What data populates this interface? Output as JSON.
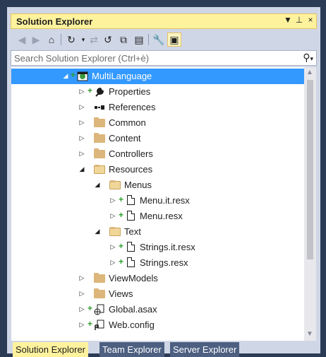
{
  "panel": {
    "title": "Solution Explorer",
    "controls": {
      "dropdown": "▼",
      "pin": "⊥",
      "close": "×"
    }
  },
  "toolbar": {
    "buttons": [
      "back-icon",
      "forward-icon",
      "home-icon",
      "history-icon",
      "sync-icon",
      "refresh-icon",
      "collapse-all-icon",
      "show-all-files-icon",
      "properties-icon",
      "preview-icon"
    ]
  },
  "search": {
    "placeholder": "Search Solution Explorer (Ctrl+è)",
    "icon": "⚲",
    "dropdown": "▾"
  },
  "tree": [
    {
      "label": "MultiLanguage",
      "icon": "project-icon",
      "expanded": true,
      "selected": true
    },
    {
      "label": "Properties",
      "icon": "wrench-icon",
      "expanded": false
    },
    {
      "label": "References",
      "icon": "references-icon",
      "expanded": false
    },
    {
      "label": "Common",
      "icon": "folder-icon",
      "expanded": false
    },
    {
      "label": "Content",
      "icon": "folder-icon",
      "expanded": false
    },
    {
      "label": "Controllers",
      "icon": "folder-icon",
      "expanded": false
    },
    {
      "label": "Resources",
      "icon": "folder-open-icon",
      "expanded": true
    },
    {
      "label": "Menus",
      "icon": "folder-open-icon",
      "expanded": true
    },
    {
      "label": "Menu.it.resx",
      "icon": "resx-file-icon",
      "expanded": false
    },
    {
      "label": "Menu.resx",
      "icon": "resx-file-icon",
      "expanded": false
    },
    {
      "label": "Text",
      "icon": "folder-open-icon",
      "expanded": true
    },
    {
      "label": "Strings.it.resx",
      "icon": "resx-file-icon",
      "expanded": false
    },
    {
      "label": "Strings.resx",
      "icon": "resx-file-icon",
      "expanded": false
    },
    {
      "label": "ViewModels",
      "icon": "folder-icon",
      "expanded": false
    },
    {
      "label": "Views",
      "icon": "folder-icon",
      "expanded": false
    },
    {
      "label": "Global.asax",
      "icon": "global-asax-icon",
      "expanded": false
    },
    {
      "label": "Web.config",
      "icon": "config-file-icon",
      "expanded": false
    }
  ],
  "tabs": [
    "Solution Explorer",
    "Team Explorer",
    "Server Explorer"
  ],
  "colors": {
    "title_active": "#fff29d",
    "selection": "#3399ff",
    "tab_inactive": "#4d6082",
    "chrome": "#cfd6e5",
    "add_marker": "#2a9d2a"
  }
}
